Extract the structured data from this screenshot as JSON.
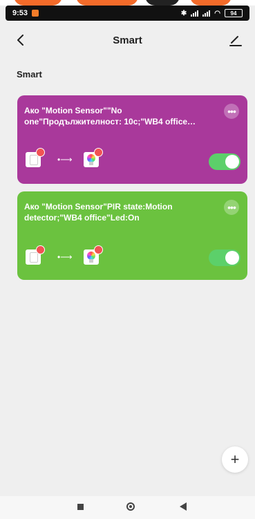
{
  "status_bar": {
    "time": "9:53",
    "battery": "94"
  },
  "header": {
    "title": "Smart",
    "back_icon": "chevron-left-icon",
    "edit_icon": "pencil-icon"
  },
  "section": {
    "title": "Smart"
  },
  "scenes": [
    {
      "description": "Ако \"Motion Sensor\"\"No one\"Продължителност: 10с;\"WB4 office…",
      "color": "#a9399b",
      "enabled": true,
      "from_device_icon": "motion-sensor-icon",
      "to_device_icon": "rgb-bulb-icon"
    },
    {
      "description": "Ако \"Motion Sensor\"PIR state:Motion detector;\"WB4 office\"Led:On",
      "color": "#6bc23f",
      "enabled": true,
      "from_device_icon": "motion-sensor-icon",
      "to_device_icon": "rgb-bulb-icon"
    }
  ],
  "fab": {
    "label": "+"
  },
  "colors": {
    "toggle_on": "#5cd06a",
    "background": "#efefef"
  }
}
